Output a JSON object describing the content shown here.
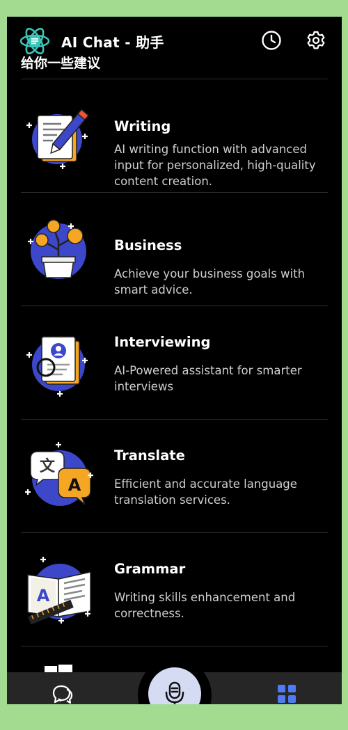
{
  "header": {
    "app_title": "AI Chat - 助手",
    "subtitle": "给你一些建议",
    "history_icon": "clock-icon",
    "settings_icon": "gear-icon"
  },
  "cards": [
    {
      "id": "writing",
      "title": "Writing",
      "description": "AI writing function with advanced input for personalized, high-quality content creation.",
      "icon": "pencil-document-icon"
    },
    {
      "id": "business",
      "title": "Business",
      "description": "Achieve your business goals with smart advice.",
      "icon": "money-plant-icon"
    },
    {
      "id": "interviewing",
      "title": "Interviewing",
      "description": "AI-Powered assistant for smarter interviews",
      "icon": "resume-magnifier-icon"
    },
    {
      "id": "translate",
      "title": "Translate",
      "description": "Efficient and accurate language translation services.",
      "icon": "translate-bubbles-icon"
    },
    {
      "id": "grammar",
      "title": "Grammar",
      "description": "Writing skills enhancement and correctness.",
      "icon": "grammar-book-icon"
    }
  ],
  "bottom_nav": {
    "chat_icon": "chat-bubbles-icon",
    "mic_icon": "microphone-icon",
    "apps_icon": "apps-grid-icon"
  },
  "colors": {
    "background": "#000000",
    "frame": "#a3dc91",
    "accent_blue": "#3c47c9",
    "accent_orange": "#f5a623",
    "logo_teal": "#39c6b8",
    "nav_active": "#4f7bf2",
    "mic_bg": "#d6dbf4"
  }
}
